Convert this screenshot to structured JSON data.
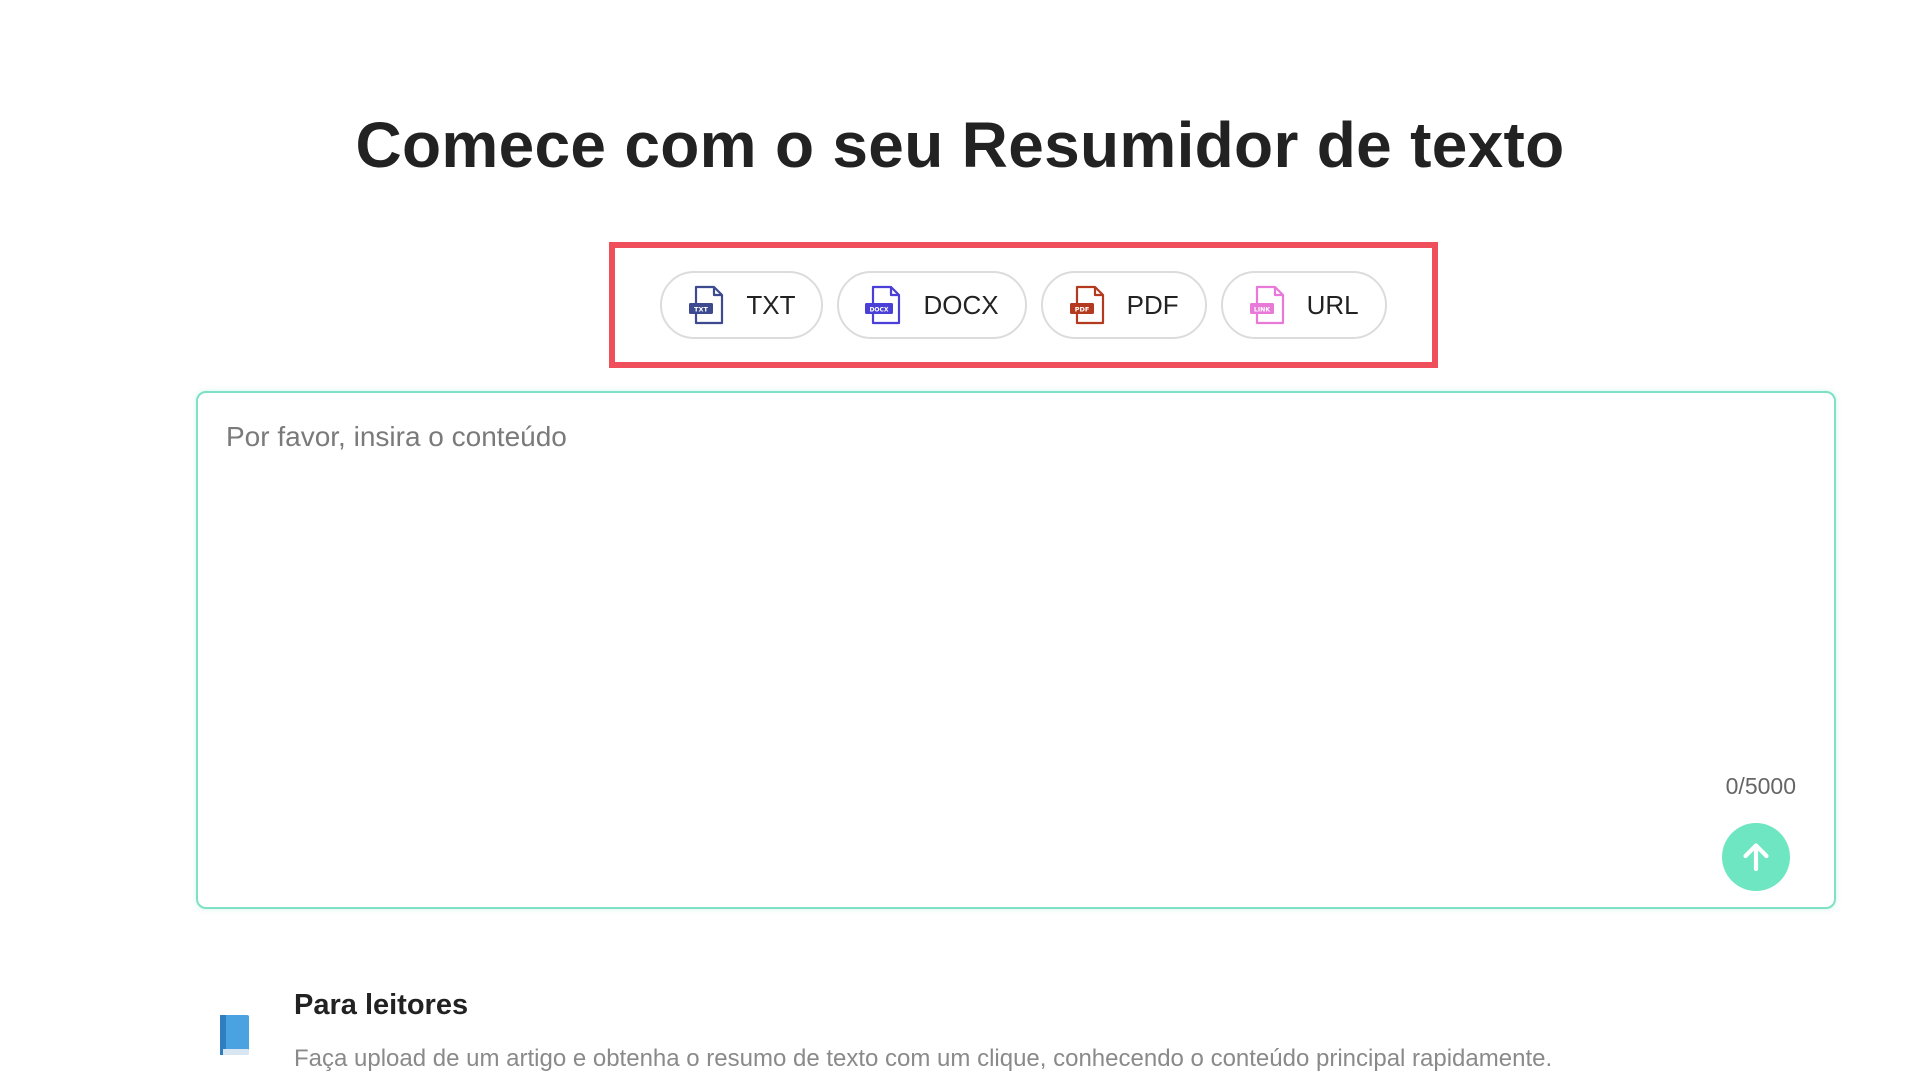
{
  "header": {
    "title": "Comece com o seu Resumidor de texto"
  },
  "formats": [
    {
      "label": "TXT",
      "icon": "txt-file-icon",
      "color": "#3d4a8f",
      "tag": "TXT"
    },
    {
      "label": "DOCX",
      "icon": "docx-file-icon",
      "color": "#4a3fd6",
      "tag": "DOCX"
    },
    {
      "label": "PDF",
      "icon": "pdf-file-icon",
      "color": "#b33a1f",
      "tag": "PDF"
    },
    {
      "label": "URL",
      "icon": "link-file-icon",
      "color": "#e879d8",
      "tag": "LINK"
    }
  ],
  "editor": {
    "placeholder": "Por favor, insira o conteúdo",
    "value": "",
    "char_count": "0/5000",
    "submit_icon": "arrow-up-icon"
  },
  "features": [
    {
      "icon": "book-icon",
      "title": "Para leitores",
      "description": "Faça upload de um artigo e obtenha o resumo de texto com um clique, conhecendo o conteúdo principal rapidamente."
    }
  ],
  "colors": {
    "highlight_border": "#ef4f5a",
    "accent": "#6ee6c2",
    "editor_border": "#7fe0c6"
  }
}
